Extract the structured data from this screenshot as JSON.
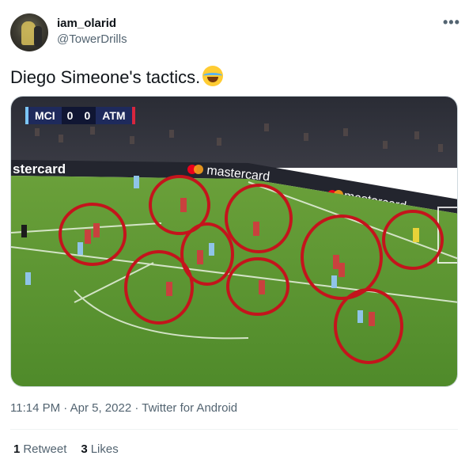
{
  "author": {
    "display_name": "iam_olarid",
    "handle": "@TowerDrills",
    "avatar_icon": "profile-avatar"
  },
  "more_icon": "more-horizontal-icon",
  "tweet_text": "Diego Simeone's tactics.",
  "emoji": "face-with-tears-of-joy",
  "media": {
    "scoreboard": {
      "home": "MCI",
      "home_score": "0",
      "away_score": "0",
      "away": "ATM"
    },
    "ad_boards": {
      "left": "stercard",
      "center": "mastercard",
      "right": "mastercard"
    },
    "annotation_color": "#c4141c",
    "home_kit_color": "#8fc4e8",
    "away_kit_color": "#c9413e"
  },
  "meta": {
    "time": "11:14 PM",
    "separator": "·",
    "date": "Apr 5, 2022",
    "source": "Twitter for Android"
  },
  "stats": {
    "retweets": "1",
    "retweets_label": "Retweet",
    "likes": "3",
    "likes_label": "Likes"
  }
}
